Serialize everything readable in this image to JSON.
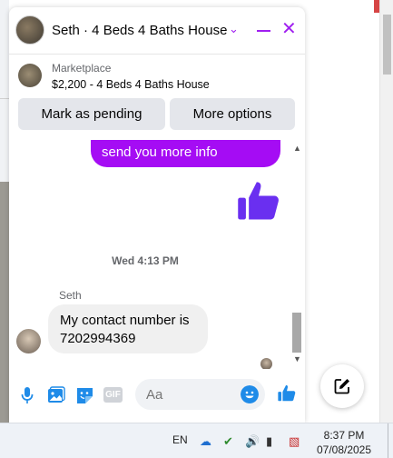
{
  "colors": {
    "accent": "#a50cf4",
    "like_blue": "#1f8be8",
    "bubble_in": "#f0f0f0"
  },
  "header": {
    "title": "Seth · 4 Beds 4 Baths House",
    "chevron_icon": "chevron-down-icon",
    "minimize_icon": "minus-icon",
    "close_icon": "close-icon"
  },
  "marketplace": {
    "label": "Marketplace",
    "item": "$2,200 - 4 Beds 4 Baths House",
    "pending_label": "Mark as pending",
    "more_label": "More options"
  },
  "messages": {
    "outgoing_text": "send you more info",
    "timestamp": "Wed 4:13 PM",
    "sender": "Seth",
    "incoming_text": "My contact number is 7202994369"
  },
  "composer": {
    "placeholder": "Aa",
    "icons": [
      "microphone-icon",
      "image-icon",
      "sticker-icon",
      "gif-icon",
      "emoji-icon",
      "like-icon"
    ],
    "gif_label": "GIF"
  },
  "taskbar": {
    "lang": "EN",
    "time": "8:37 PM",
    "date": "07/08/2025"
  }
}
